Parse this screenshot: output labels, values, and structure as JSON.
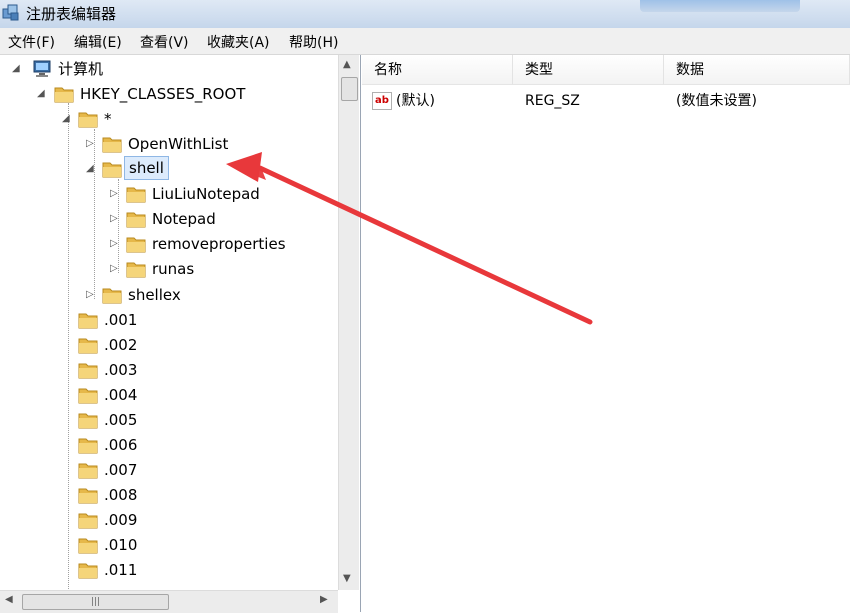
{
  "window": {
    "title": "注册表编辑器"
  },
  "menu": [
    "文件(F)",
    "编辑(E)",
    "查看(V)",
    "收藏夹(A)",
    "帮助(H)"
  ],
  "tree": {
    "computer": "计算机",
    "root": "HKEY_CLASSES_ROOT",
    "star": "*",
    "open_with_list": "OpenWithList",
    "shell": "shell",
    "shell_children": [
      "LiuLiuNotepad",
      "Notepad",
      "removeproperties",
      "runas"
    ],
    "shellex": "shellex",
    "extensions": [
      ".001",
      ".002",
      ".003",
      ".004",
      ".005",
      ".006",
      ".007",
      ".008",
      ".009",
      ".010",
      ".011"
    ]
  },
  "columns": {
    "name": "名称",
    "type": "类型",
    "data": "数据"
  },
  "values": [
    {
      "name": "(默认)",
      "type": "REG_SZ",
      "data": "(数值未设置)"
    }
  ],
  "colors": {
    "arrow": "#e8383b",
    "folder": "#e6b84a",
    "selection": "#dcebfc"
  }
}
